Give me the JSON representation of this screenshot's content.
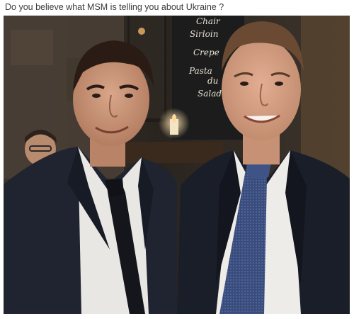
{
  "post": {
    "caption": "Do you believe what MSM is telling you about Ukraine ?",
    "photo": {
      "kind": "photograph",
      "subject": "two men in dark suits posing in a restaurant",
      "colors": {
        "background": "#2a241f",
        "wall": "#4a4036",
        "suit": "#1f2430",
        "shirt": "#e9e7e3",
        "left_tie": "#14161c",
        "right_tie": "#3a4c7a",
        "skin": "#c89478",
        "hair": "#2a1c14",
        "candle": "#ffd79a"
      },
      "menu_board_text": [
        "Chair",
        "Sirloin",
        "Crepe",
        "Pasta",
        "du",
        "Salad"
      ]
    }
  }
}
